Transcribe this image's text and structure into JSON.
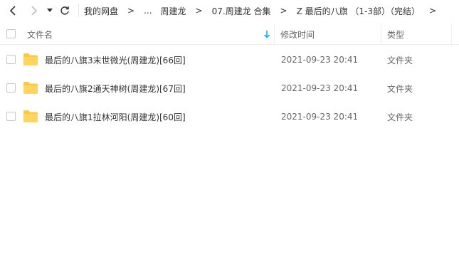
{
  "toolbar": {
    "back_icon": "chevron-left-icon",
    "forward_icon": "chevron-right-icon",
    "dropdown_icon": "caret-down-icon",
    "refresh_icon": "refresh-icon"
  },
  "breadcrumb": {
    "items": [
      "我的网盘",
      "...",
      "周建龙",
      "07.周建龙 合集",
      "Z 最后的八旗 （1-3部）（完结）"
    ],
    "separator": ">"
  },
  "header": {
    "name_label": "文件名",
    "time_label": "修改时间",
    "type_label": "类型",
    "sort_icon": "sort-down-arrow-icon"
  },
  "files": [
    {
      "name": "最后的八旗3末世微光(周建龙)[66回]",
      "modified": "2021-09-23 20:41",
      "type": "文件夹"
    },
    {
      "name": "最后的八旗2通天神树(周建龙)[67回]",
      "modified": "2021-09-23 20:41",
      "type": "文件夹"
    },
    {
      "name": "最后的八旗1拉林河阳(周建龙)[60回]",
      "modified": "2021-09-23 20:41",
      "type": "文件夹"
    }
  ],
  "colors": {
    "folder": "#ffc83d",
    "accent": "#06a7ff",
    "text": "#333333",
    "muted": "#666666"
  }
}
